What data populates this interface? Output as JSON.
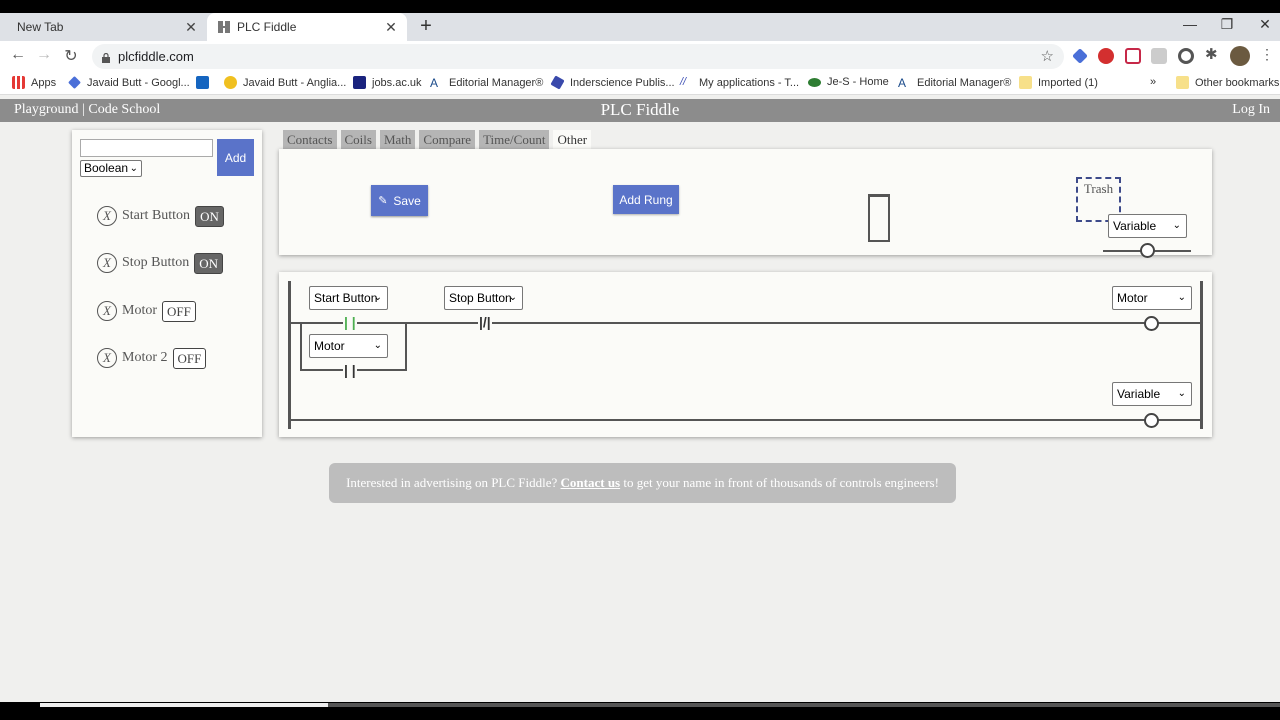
{
  "browser": {
    "tabs": [
      {
        "title": "New Tab"
      },
      {
        "title": "PLC Fiddle"
      }
    ],
    "url": "plcfiddle.com",
    "bookmarks": [
      "Apps",
      "Javaid Butt - Googl...",
      "Javaid Butt - Anglia...",
      "jobs.ac.uk",
      "Editorial Manager®",
      "Inderscience Publis...",
      "My applications - T...",
      "Je-S - Home",
      "Editorial Manager®",
      "Imported (1)",
      "»",
      "Other bookmarks"
    ]
  },
  "header": {
    "nav_playground": "Playground",
    "nav_sep": " | ",
    "nav_codeschool": "Code School",
    "title": "PLC Fiddle",
    "login": "Log In"
  },
  "variables": {
    "name_input_value": "",
    "type_selected": "Boolean",
    "add_label": "Add",
    "items": [
      {
        "name": "Start Button",
        "state": "ON"
      },
      {
        "name": "Stop Button",
        "state": "ON"
      },
      {
        "name": "Motor",
        "state": "OFF"
      },
      {
        "name": "Motor 2",
        "state": "OFF"
      }
    ],
    "remove_glyph": "X"
  },
  "toolbox": {
    "tabs": [
      "Contacts",
      "Coils",
      "Math",
      "Compare",
      "Time/Count",
      "Other"
    ],
    "active_tab": "Other",
    "save_label": "Save",
    "save_icon": "✎",
    "add_rung_label": "Add Rung",
    "trash_label": "Trash",
    "coil_variable": "Variable"
  },
  "ladder": {
    "rung1": {
      "contact1": "Start Button",
      "contact2": "Stop Button",
      "branch_contact": "Motor",
      "coil": "Motor"
    },
    "rung2": {
      "coil": "Variable"
    }
  },
  "ad": {
    "prefix": "Interested in advertising on PLC Fiddle? ",
    "link": "Contact us",
    "suffix": " to get your name in front of thousands of controls engineers!"
  },
  "colors": {
    "button_blue": "#5a73c9",
    "header_gray": "#8c8c8c",
    "contact_green": "#4caf50",
    "trash_border": "#3d4a8a"
  }
}
